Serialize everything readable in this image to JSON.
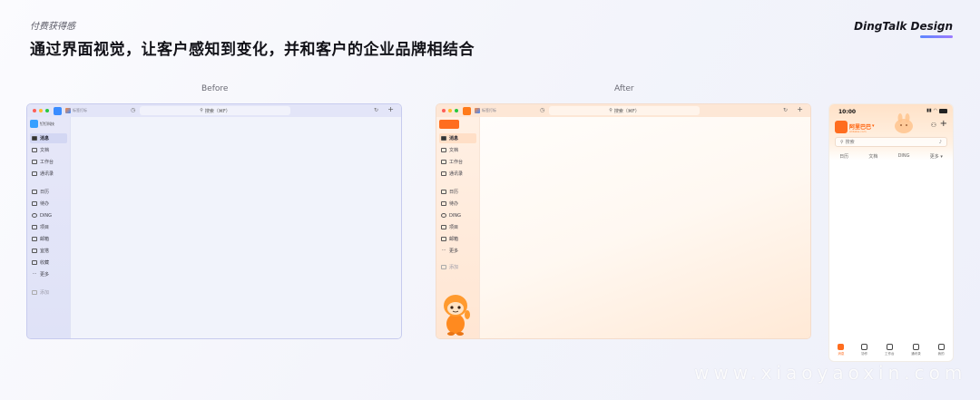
{
  "header": {
    "kicker": "付费获得感",
    "headline": "通过界面视觉，让客户感知到变化，并和客户的企业品牌相结合",
    "brand": "DingTalk Design"
  },
  "captions": {
    "before": "Before",
    "after": "After"
  },
  "colors": {
    "before_accent": "#3a8cff",
    "after_accent": "#ff6d1f",
    "brand_bar": "#7a80ff"
  },
  "desktop": {
    "tab_label": "标签打标",
    "search_placeholder": "搜索（⌘F）",
    "clock_icon": "clock-icon",
    "refresh_icon": "refresh-icon",
    "plus": "+"
  },
  "before": {
    "org_name": "钉钉科技",
    "nav": [
      {
        "label": "消息",
        "active": true
      },
      {
        "label": "文档"
      },
      {
        "label": "工作台"
      },
      {
        "label": "通讯录"
      },
      {
        "label": "日历"
      },
      {
        "label": "待办"
      },
      {
        "label": "DING"
      },
      {
        "label": "项目"
      },
      {
        "label": "邮箱"
      },
      {
        "label": "宜搭"
      },
      {
        "label": "收藏"
      },
      {
        "label": "更多"
      }
    ],
    "add_label": "添加"
  },
  "after": {
    "org_name": "阿里巴巴",
    "nav": [
      {
        "label": "消息",
        "active": true
      },
      {
        "label": "文档"
      },
      {
        "label": "工作台"
      },
      {
        "label": "通讯录"
      },
      {
        "label": "日历"
      },
      {
        "label": "待办"
      },
      {
        "label": "DING"
      },
      {
        "label": "项目"
      },
      {
        "label": "邮箱"
      },
      {
        "label": "更多"
      }
    ],
    "add_label": "添加"
  },
  "phone": {
    "time": "10:00",
    "org_name": "阿里巴巴",
    "org_sub": "Alibaba.com",
    "caret": "▾",
    "search_placeholder": "搜索",
    "tabs": [
      "日历",
      "文档",
      "DING",
      "更多 ▾"
    ],
    "bottom_nav": [
      {
        "label": "消息",
        "active": true
      },
      {
        "label": "协作"
      },
      {
        "label": "工作台"
      },
      {
        "label": "通讯录"
      },
      {
        "label": "我的"
      }
    ]
  },
  "watermark": "www.xiaoyaoxin.com"
}
